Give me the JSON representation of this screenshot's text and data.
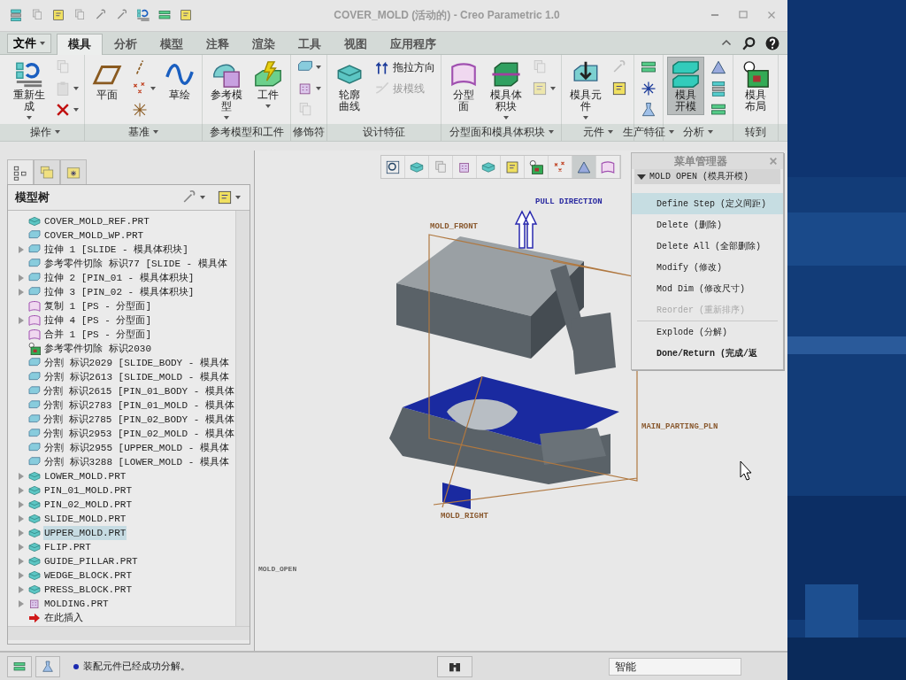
{
  "window": {
    "title": "COVER_MOLD (活动的) - Creo Parametric 1.0"
  },
  "file_menu": {
    "label": "文件"
  },
  "tabs": [
    {
      "label": "模具",
      "selected": true
    },
    {
      "label": "分析",
      "selected": false
    },
    {
      "label": "模型",
      "selected": false
    },
    {
      "label": "注释",
      "selected": false
    },
    {
      "label": "渲染",
      "selected": false
    },
    {
      "label": "工具",
      "selected": false
    },
    {
      "label": "视图",
      "selected": false
    },
    {
      "label": "应用程序",
      "selected": false
    }
  ],
  "ribbon_groups": [
    {
      "label": "操作",
      "dropdown": true,
      "items": [
        {
          "kind": "large",
          "label": "重新生成",
          "dropdown": true,
          "selected": false
        },
        {
          "kind": "icon",
          "disabled": true,
          "dropdown": false
        },
        {
          "kind": "icon",
          "disabled": true,
          "dropdown": true
        },
        {
          "kind": "icon",
          "disabled": false,
          "dropdown": true
        }
      ]
    },
    {
      "label": "基准",
      "dropdown": true,
      "items": [
        {
          "kind": "large",
          "label": "平面",
          "dropdown": false,
          "selected": false
        },
        {
          "kind": "icon",
          "disabled": false,
          "dropdown": false
        },
        {
          "kind": "icon",
          "disabled": false,
          "dropdown": true
        },
        {
          "kind": "icon",
          "disabled": false,
          "dropdown": false
        },
        {
          "kind": "large",
          "label": "草绘",
          "dropdown": false,
          "selected": false
        }
      ]
    },
    {
      "label": "参考模型和工件",
      "dropdown": false,
      "items": [
        {
          "kind": "large",
          "label": "参考模型",
          "dropdown": true,
          "selected": false
        },
        {
          "kind": "large",
          "label": "工件",
          "dropdown": true,
          "selected": false
        }
      ]
    },
    {
      "label": "修饰符",
      "dropdown": false,
      "items": [
        {
          "kind": "icon",
          "disabled": false,
          "dropdown": true
        },
        {
          "kind": "icon",
          "disabled": false,
          "dropdown": true
        },
        {
          "kind": "icon",
          "disabled": true,
          "dropdown": false
        }
      ]
    },
    {
      "label": "设计特征",
      "dropdown": false,
      "items": [
        {
          "kind": "large",
          "label": "轮廓曲线",
          "dropdown": false,
          "selected": false
        },
        {
          "kind": "text",
          "label": "拖拉方向",
          "disabled": false
        },
        {
          "kind": "text",
          "label": "拔模线",
          "disabled": true
        }
      ]
    },
    {
      "label": "分型面和模具体积块",
      "dropdown": true,
      "items": [
        {
          "kind": "large",
          "label": "分型面",
          "dropdown": false,
          "selected": false
        },
        {
          "kind": "large",
          "label": "模具体积块",
          "dropdown": true,
          "selected": false
        },
        {
          "kind": "icon",
          "disabled": true,
          "dropdown": false
        },
        {
          "kind": "icon",
          "disabled": true,
          "dropdown": true
        }
      ]
    },
    {
      "label": "元件",
      "dropdown": true,
      "items": [
        {
          "kind": "large",
          "label": "模具元件",
          "dropdown": true,
          "selected": false
        },
        {
          "kind": "icon",
          "disabled": true,
          "dropdown": false
        },
        {
          "kind": "icon",
          "disabled": false,
          "dropdown": false
        }
      ]
    },
    {
      "label": "生产特征",
      "dropdown": true,
      "items": [
        {
          "kind": "icon",
          "disabled": false,
          "dropdown": false
        },
        {
          "kind": "icon",
          "disabled": false,
          "dropdown": false
        },
        {
          "kind": "icon",
          "disabled": false,
          "dropdown": false
        }
      ]
    },
    {
      "label": "分析",
      "dropdown": true,
      "items": [
        {
          "kind": "large",
          "label": "模具开模",
          "dropdown": false,
          "selected": true
        },
        {
          "kind": "icon",
          "disabled": false,
          "dropdown": false
        },
        {
          "kind": "icon",
          "disabled": false,
          "dropdown": false
        },
        {
          "kind": "icon",
          "disabled": false,
          "dropdown": false
        }
      ]
    },
    {
      "label": "转到",
      "dropdown": false,
      "items": [
        {
          "kind": "large",
          "label": "模具布局",
          "dropdown": false,
          "selected": false
        }
      ]
    }
  ],
  "navigator_tabs": [
    {
      "selected": true
    },
    {
      "selected": false
    },
    {
      "selected": false
    }
  ],
  "model_tree": {
    "title": "模型树",
    "items": [
      {
        "label": "COVER_MOLD_REF.PRT",
        "kind": "ref",
        "expandable": false,
        "selected": false
      },
      {
        "label": "COVER_MOLD_WP.PRT",
        "kind": "wp",
        "expandable": false,
        "selected": false
      },
      {
        "label": "拉伸 1 [SLIDE - 模具体积块]",
        "kind": "feature",
        "expandable": true,
        "selected": false
      },
      {
        "label": "参考零件切除 标识77 [SLIDE - 模具体",
        "kind": "feature",
        "expandable": false,
        "selected": false
      },
      {
        "label": "拉伸 2 [PIN_01 - 模具体积块]",
        "kind": "feature",
        "expandable": true,
        "selected": false
      },
      {
        "label": "拉伸 3 [PIN_02 - 模具体积块]",
        "kind": "feature",
        "expandable": true,
        "selected": false
      },
      {
        "label": "复制 1 [PS - 分型面]",
        "kind": "surface",
        "expandable": false,
        "selected": false
      },
      {
        "label": "拉伸 4 [PS - 分型面]",
        "kind": "surface",
        "expandable": true,
        "selected": false
      },
      {
        "label": "合并 1 [PS - 分型面]",
        "kind": "surface",
        "expandable": false,
        "selected": false
      },
      {
        "label": "参考零件切除 标识2030",
        "kind": "cut",
        "expandable": false,
        "selected": false
      },
      {
        "label": "分割 标识2029 [SLIDE_BODY - 模具体",
        "kind": "feature",
        "expandable": false,
        "selected": false
      },
      {
        "label": "分割 标识2613 [SLIDE_MOLD - 模具体",
        "kind": "feature",
        "expandable": false,
        "selected": false
      },
      {
        "label": "分割 标识2615 [PIN_01_BODY - 模具体",
        "kind": "feature",
        "expandable": false,
        "selected": false
      },
      {
        "label": "分割 标识2783 [PIN_01_MOLD - 模具体",
        "kind": "feature",
        "expandable": false,
        "selected": false
      },
      {
        "label": "分割 标识2785 [PIN_02_BODY - 模具体",
        "kind": "feature",
        "expandable": false,
        "selected": false
      },
      {
        "label": "分割 标识2953 [PIN_02_MOLD - 模具体",
        "kind": "feature",
        "expandable": false,
        "selected": false
      },
      {
        "label": "分割 标识2955 [UPPER_MOLD - 模具体",
        "kind": "feature",
        "expandable": false,
        "selected": false
      },
      {
        "label": "分割 标识3288 [LOWER_MOLD - 模具体",
        "kind": "feature",
        "expandable": false,
        "selected": false
      },
      {
        "label": "LOWER_MOLD.PRT",
        "kind": "part",
        "expandable": true,
        "selected": false
      },
      {
        "label": "PIN_01_MOLD.PRT",
        "kind": "part",
        "expandable": true,
        "selected": false
      },
      {
        "label": "PIN_02_MOLD.PRT",
        "kind": "part",
        "expandable": true,
        "selected": false
      },
      {
        "label": "SLIDE_MOLD.PRT",
        "kind": "part",
        "expandable": true,
        "selected": false
      },
      {
        "label": "UPPER_MOLD.PRT",
        "kind": "part",
        "expandable": true,
        "selected": true
      },
      {
        "label": "FLIP.PRT",
        "kind": "part",
        "expandable": true,
        "selected": false
      },
      {
        "label": "GUIDE_PILLAR.PRT",
        "kind": "part",
        "expandable": true,
        "selected": false
      },
      {
        "label": "WEDGE_BLOCK.PRT",
        "kind": "part",
        "expandable": true,
        "selected": false
      },
      {
        "label": "PRESS_BLOCK.PRT",
        "kind": "part",
        "expandable": true,
        "selected": false
      },
      {
        "label": "MOLDING.PRT",
        "kind": "molding",
        "expandable": true,
        "selected": false
      },
      {
        "label": "在此插入",
        "kind": "insert",
        "expandable": false,
        "selected": false
      }
    ]
  },
  "view_toolbar": [
    {
      "selected": false
    },
    {
      "selected": false
    },
    {
      "selected": false
    },
    {
      "selected": false
    },
    {
      "selected": false
    },
    {
      "selected": false
    },
    {
      "selected": false
    },
    {
      "selected": false
    },
    {
      "selected": true
    },
    {
      "selected": false
    }
  ],
  "view_labels": [
    {
      "text": "PULL DIRECTION",
      "kind": "direction"
    },
    {
      "text": "MOLD_FRONT",
      "kind": "datum"
    },
    {
      "text": "MAIN_PARTING_PLN",
      "kind": "datum"
    },
    {
      "text": "MOLD_RIGHT",
      "kind": "datum"
    },
    {
      "text": "MOLD_OPEN",
      "kind": "note"
    }
  ],
  "menu_manager": {
    "title": "菜单管理器",
    "header": {
      "label": "MOLD OPEN (模具开模)",
      "expanded": true
    },
    "items": [
      {
        "label": "Define Step (定义间距)",
        "selected": true,
        "disabled": false,
        "emphasis": false,
        "separator_before": false
      },
      {
        "label": "Delete (删除)",
        "selected": false,
        "disabled": false,
        "emphasis": false,
        "separator_before": false
      },
      {
        "label": "Delete All (全部删除)",
        "selected": false,
        "disabled": false,
        "emphasis": false,
        "separator_before": false
      },
      {
        "label": "Modify (修改)",
        "selected": false,
        "disabled": false,
        "emphasis": false,
        "separator_before": false
      },
      {
        "label": "Mod Dim (修改尺寸)",
        "selected": false,
        "disabled": false,
        "emphasis": false,
        "separator_before": false
      },
      {
        "label": "Reorder (重新排序)",
        "selected": false,
        "disabled": true,
        "emphasis": false,
        "separator_before": false
      },
      {
        "label": "Explode (分解)",
        "selected": false,
        "disabled": false,
        "emphasis": false,
        "separator_before": true
      },
      {
        "label": "Done/Return (完成/返",
        "selected": false,
        "disabled": false,
        "emphasis": true,
        "separator_before": false
      }
    ]
  },
  "status_bar": {
    "message": "装配元件已经成功分解。",
    "filter": "智能"
  }
}
